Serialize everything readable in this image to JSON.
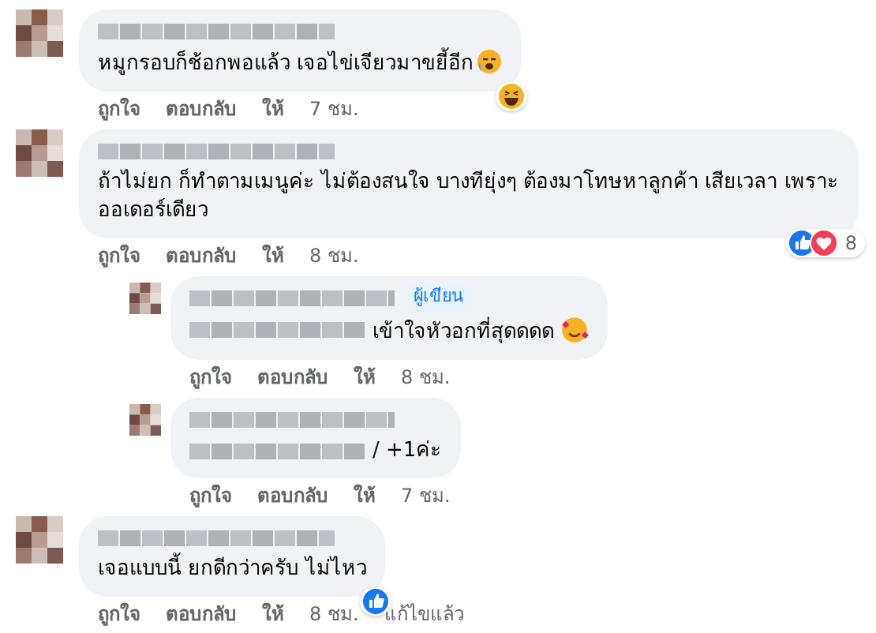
{
  "comments": [
    {
      "kind": "comment",
      "text_prefix_blurred": false,
      "text": "หมูกรอบก็ช้อกพอแล้ว เจอไข่เจียวมาขยี้อีก",
      "emoji": {
        "kind": "crying"
      },
      "reactions": [
        {
          "kind": "haha"
        }
      ],
      "actions": [
        "ถูกใจ",
        "ตอบกลับ",
        "ให้"
      ],
      "time": "7 ชม."
    },
    {
      "kind": "comment",
      "text_prefix_blurred": false,
      "text": "ถ้าไม่ยก ก็ทำตามเมนูค่ะ ไม่ต้องสนใจ บางทียุ่งๆ ต้องมาโทษหาลูกค้า เสียเวลา เพราะออเดอร์เดียว",
      "reactions": [
        {
          "kind": "like"
        },
        {
          "kind": "love"
        }
      ],
      "reaction_count": "8",
      "actions": [
        "ถูกใจ",
        "ตอบกลับ",
        "ให้"
      ],
      "time": "8 ชม."
    },
    {
      "kind": "reply",
      "author_badge": "ผู้เขียน",
      "text_prefix_blurred": true,
      "text": "เข้าใจหัวอกที่สุดดดด",
      "emoji": {
        "kind": "hearts"
      },
      "actions": [
        "ถูกใจ",
        "ตอบกลับ",
        "ให้"
      ],
      "time": "8 ชม."
    },
    {
      "kind": "reply",
      "text_prefix_blurred": true,
      "text": "/ +1ค่ะ",
      "actions": [
        "ถูกใจ",
        "ตอบกลับ",
        "ให้"
      ],
      "time": "7 ชม."
    },
    {
      "kind": "comment",
      "text_prefix_blurred": false,
      "text": "เจอแบบนี้ ยกดีกว่าครับ ไม่ไหว",
      "reactions": [
        {
          "kind": "like"
        }
      ],
      "actions": [
        "ถูกใจ",
        "ตอบกลับ",
        "ให้"
      ],
      "time": "8 ชม.",
      "edited": "แก้ไขแล้ว"
    }
  ]
}
